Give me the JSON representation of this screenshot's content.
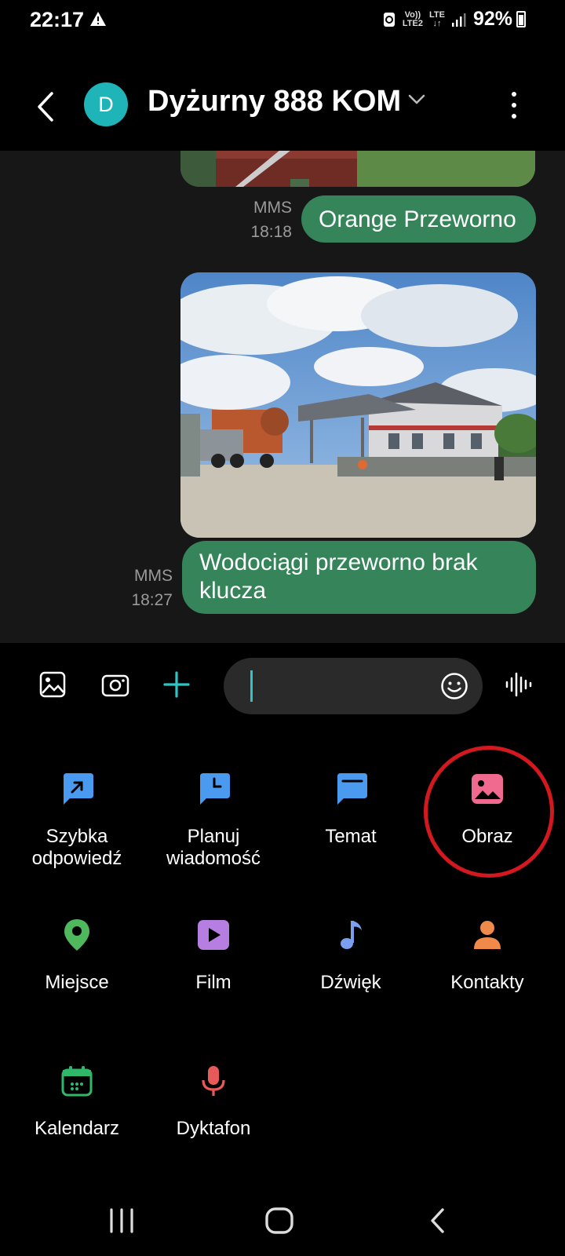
{
  "status": {
    "time": "22:17",
    "volte_top": "Vo))",
    "volte_bottom": "LTE2",
    "lte": "LTE",
    "battery": "92%"
  },
  "header": {
    "avatar_letter": "D",
    "contact_name": "Dyżurny 888 KOM"
  },
  "messages": [
    {
      "text": "Orange Przeworno",
      "type": "MMS",
      "time": "18:18"
    },
    {
      "text": "Wodociągi przeworno brak klucza",
      "type": "MMS",
      "time": "18:27"
    }
  ],
  "composer": {
    "value": "",
    "placeholder": ""
  },
  "attachments": [
    {
      "label": "Szybka odpowiedź",
      "icon": "quick-reply-icon",
      "color": "#4a9af0"
    },
    {
      "label": "Planuj wiadomość",
      "icon": "schedule-message-icon",
      "color": "#4a9af0"
    },
    {
      "label": "Temat",
      "icon": "subject-icon",
      "color": "#4a9af0"
    },
    {
      "label": "Obraz",
      "icon": "image-icon",
      "color": "#f06a90"
    },
    {
      "label": "Miejsce",
      "icon": "location-pin-icon",
      "color": "#4fb85c"
    },
    {
      "label": "Film",
      "icon": "video-icon",
      "color": "#b57ee0"
    },
    {
      "label": "Dźwięk",
      "icon": "music-note-icon",
      "color": "#7b9ef0"
    },
    {
      "label": "Kontakty",
      "icon": "contact-person-icon",
      "color": "#f08a4b"
    },
    {
      "label": "Kalendarz",
      "icon": "calendar-icon",
      "color": "#2fb86a"
    },
    {
      "label": "Dyktafon",
      "icon": "microphone-icon",
      "color": "#e85a5a"
    }
  ],
  "colors": {
    "bubble": "#35845a",
    "accent": "#2fc4c6",
    "highlight": "#d31820"
  }
}
